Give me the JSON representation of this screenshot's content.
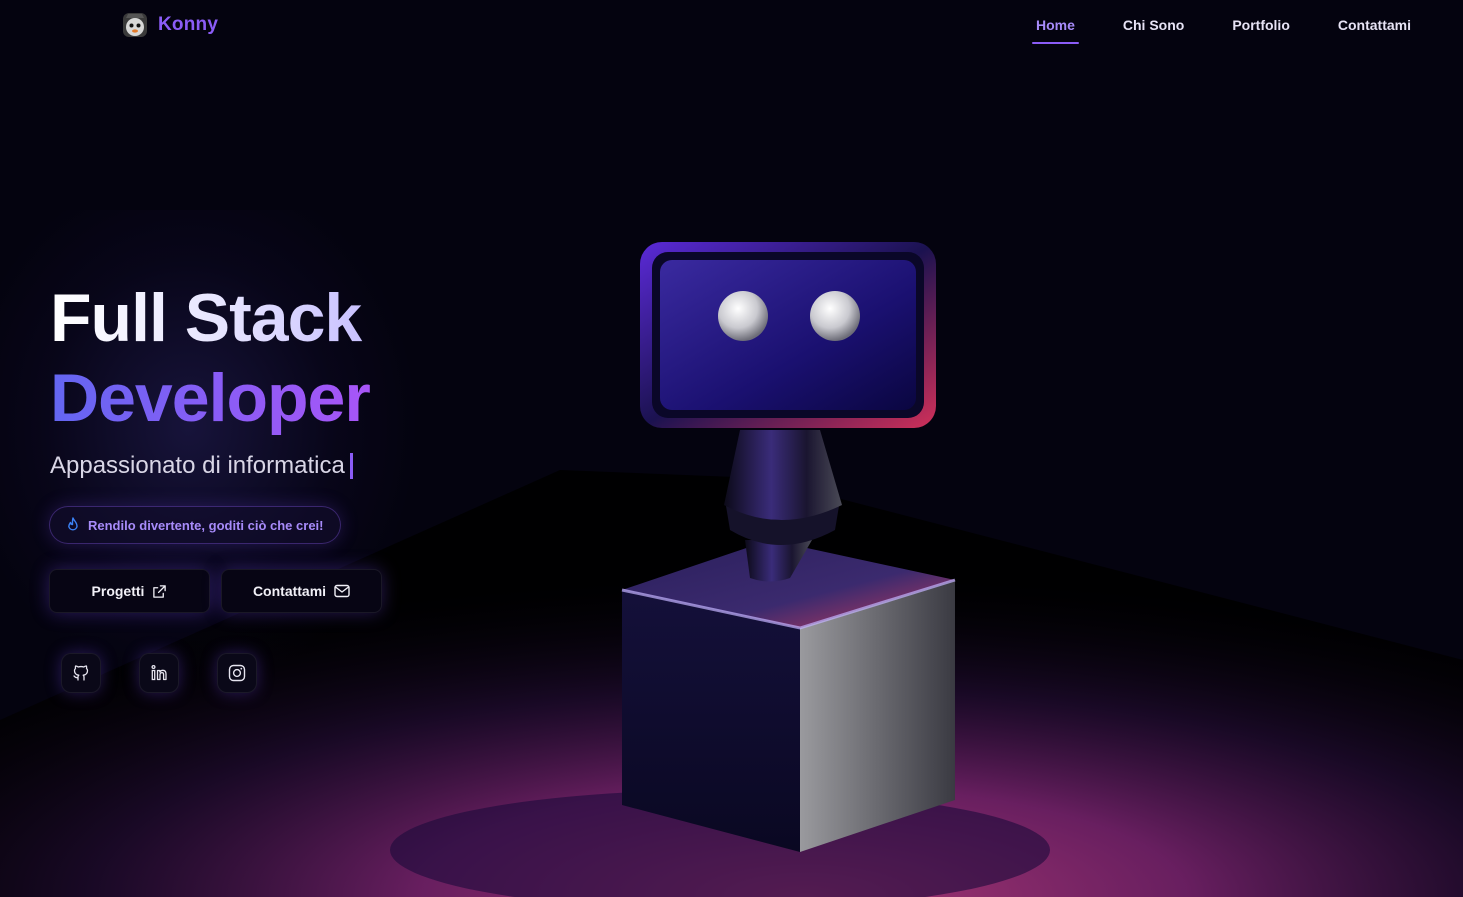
{
  "brand": {
    "name": "Konny",
    "logo_icon": "avatar-logo-icon"
  },
  "nav": {
    "items": [
      {
        "label": "Home",
        "active": true
      },
      {
        "label": "Chi Sono",
        "active": false
      },
      {
        "label": "Portfolio",
        "active": false
      },
      {
        "label": "Contattami",
        "active": false
      }
    ]
  },
  "hero": {
    "title_line1": "Full Stack",
    "title_line2": "Developer",
    "tagline": "Appassionato di informatica",
    "badge": {
      "icon": "flame-icon",
      "text": "Rendilo divertente, goditi ciò che crei!"
    },
    "buttons": {
      "projects": {
        "label": "Progetti",
        "icon": "external-link-icon"
      },
      "contact": {
        "label": "Contattami",
        "icon": "mail-icon"
      }
    },
    "socials": [
      {
        "icon": "github-icon"
      },
      {
        "icon": "linkedin-icon"
      },
      {
        "icon": "instagram-icon"
      }
    ]
  },
  "colors": {
    "background": "#04030f",
    "accent": "#8b5cf6",
    "accent_light": "#a78bfa",
    "floor_glow": "#a0306f"
  }
}
